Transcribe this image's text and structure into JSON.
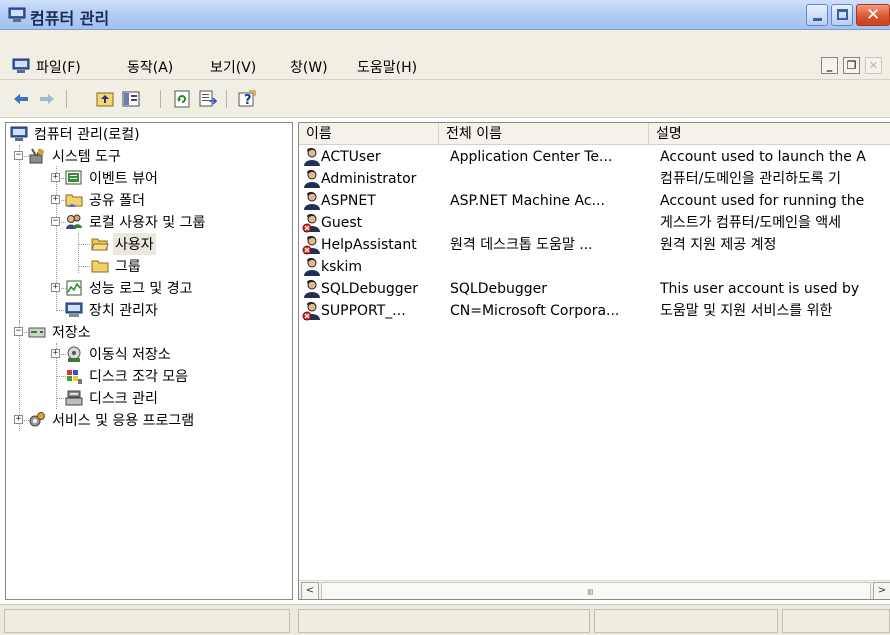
{
  "window": {
    "title": "컴퓨터 관리"
  },
  "menu": {
    "file": "파일(F)",
    "action": "동작(A)",
    "view": "보기(V)",
    "window": "창(W)",
    "help": "도움말(H)"
  },
  "toolbar": {
    "icons": [
      "back-arrow-icon",
      "forward-arrow-icon",
      "up-one-level-icon",
      "show-hide-tree-icon",
      "refresh-icon",
      "export-list-icon",
      "help-icon"
    ]
  },
  "tree": {
    "root": "컴퓨터 관리(로컬)",
    "system_tools": "시스템 도구",
    "event_viewer": "이벤트 뷰어",
    "shared_folders": "공유 폴더",
    "local_users_groups": "로컬 사용자 및 그룹",
    "users": "사용자",
    "groups": "그룹",
    "perf_logs": "성능 로그 및 경고",
    "device_manager": "장치 관리자",
    "storage": "저장소",
    "removable_storage": "이동식 저장소",
    "disk_defrag": "디스크 조각 모음",
    "disk_mgmt": "디스크 관리",
    "services_apps": "서비스 및 응용 프로그램",
    "selected": "users"
  },
  "list": {
    "columns": {
      "name": "이름",
      "full_name": "전체 이름",
      "description": "설명"
    },
    "rows": [
      {
        "name": "ACTUser",
        "full_name": "Application Center Te...",
        "description": "Account used to launch the A",
        "disabled": false
      },
      {
        "name": "Administrator",
        "full_name": "",
        "description": "컴퓨터/도메인을 관리하도록 기",
        "disabled": false
      },
      {
        "name": "ASPNET",
        "full_name": "ASP.NET Machine Ac...",
        "description": "Account used for running the",
        "disabled": false
      },
      {
        "name": "Guest",
        "full_name": "",
        "description": "게스트가 컴퓨터/도메인을 액세",
        "disabled": true
      },
      {
        "name": "HelpAssistant",
        "full_name": "원격 데스크톱 도움말 ...",
        "description": "원격 지원 제공 계정",
        "disabled": true
      },
      {
        "name": "kskim",
        "full_name": "",
        "description": "",
        "disabled": false
      },
      {
        "name": "SQLDebugger",
        "full_name": "SQLDebugger",
        "description": "This user account is used by",
        "disabled": false
      },
      {
        "name": "SUPPORT_...",
        "full_name": "CN=Microsoft Corpora...",
        "description": "도움말 및 지원 서비스를 위한",
        "disabled": true
      }
    ]
  },
  "scrollbar": {
    "left_arrow": "<",
    "right_arrow": ">",
    "grip": "IIII"
  },
  "colors": {
    "title_gradient_top": "#cfe0fb",
    "title_gradient_bottom": "#a4c2f0",
    "close_button": "#d9532c",
    "chrome": "#f1eee3",
    "selection": "#e9e7de",
    "disabled_badge": "#d8261c"
  }
}
